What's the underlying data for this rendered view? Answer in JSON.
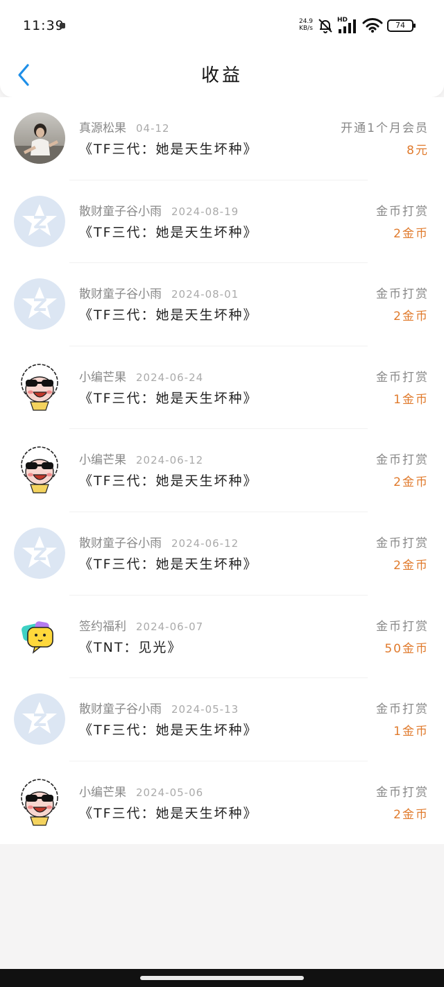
{
  "status_bar": {
    "time": "11:39",
    "net_speed_value": "24.9",
    "net_speed_unit": "KB/s",
    "network_label": "HD",
    "battery": "74"
  },
  "header": {
    "title": "收益"
  },
  "colors": {
    "accent_blue": "#1e8fe8",
    "amount_orange": "#e07a2c"
  },
  "rows": [
    {
      "avatar": "photo-avatar",
      "name": "真源松果",
      "date": "04-12",
      "title": "《TF三代：她是天生坏种》",
      "type": "开通1个月会员",
      "amount": "8元"
    },
    {
      "avatar": "star-avatar",
      "name": "散财童子谷小雨",
      "date": "2024-08-19",
      "title": "《TF三代：她是天生坏种》",
      "type": "金币打赏",
      "amount": "2金币"
    },
    {
      "avatar": "star-avatar",
      "name": "散财童子谷小雨",
      "date": "2024-08-01",
      "title": "《TF三代：她是天生坏种》",
      "type": "金币打赏",
      "amount": "2金币"
    },
    {
      "avatar": "sheep-avatar",
      "name": "小编芒果",
      "date": "2024-06-24",
      "title": "《TF三代：她是天生坏种》",
      "type": "金币打赏",
      "amount": "1金币"
    },
    {
      "avatar": "sheep-avatar",
      "name": "小编芒果",
      "date": "2024-06-12",
      "title": "《TF三代：她是天生坏种》",
      "type": "金币打赏",
      "amount": "2金币"
    },
    {
      "avatar": "star-avatar",
      "name": "散财童子谷小雨",
      "date": "2024-06-12",
      "title": "《TF三代：她是天生坏种》",
      "type": "金币打赏",
      "amount": "2金币"
    },
    {
      "avatar": "chat-avatar",
      "name": "签约福利",
      "date": "2024-06-07",
      "title": "《TNT：见光》",
      "type": "金币打赏",
      "amount": "50金币"
    },
    {
      "avatar": "star-avatar",
      "name": "散财童子谷小雨",
      "date": "2024-05-13",
      "title": "《TF三代：她是天生坏种》",
      "type": "金币打赏",
      "amount": "1金币"
    },
    {
      "avatar": "sheep-avatar",
      "name": "小编芒果",
      "date": "2024-05-06",
      "title": "《TF三代：她是天生坏种》",
      "type": "金币打赏",
      "amount": "2金币"
    }
  ]
}
